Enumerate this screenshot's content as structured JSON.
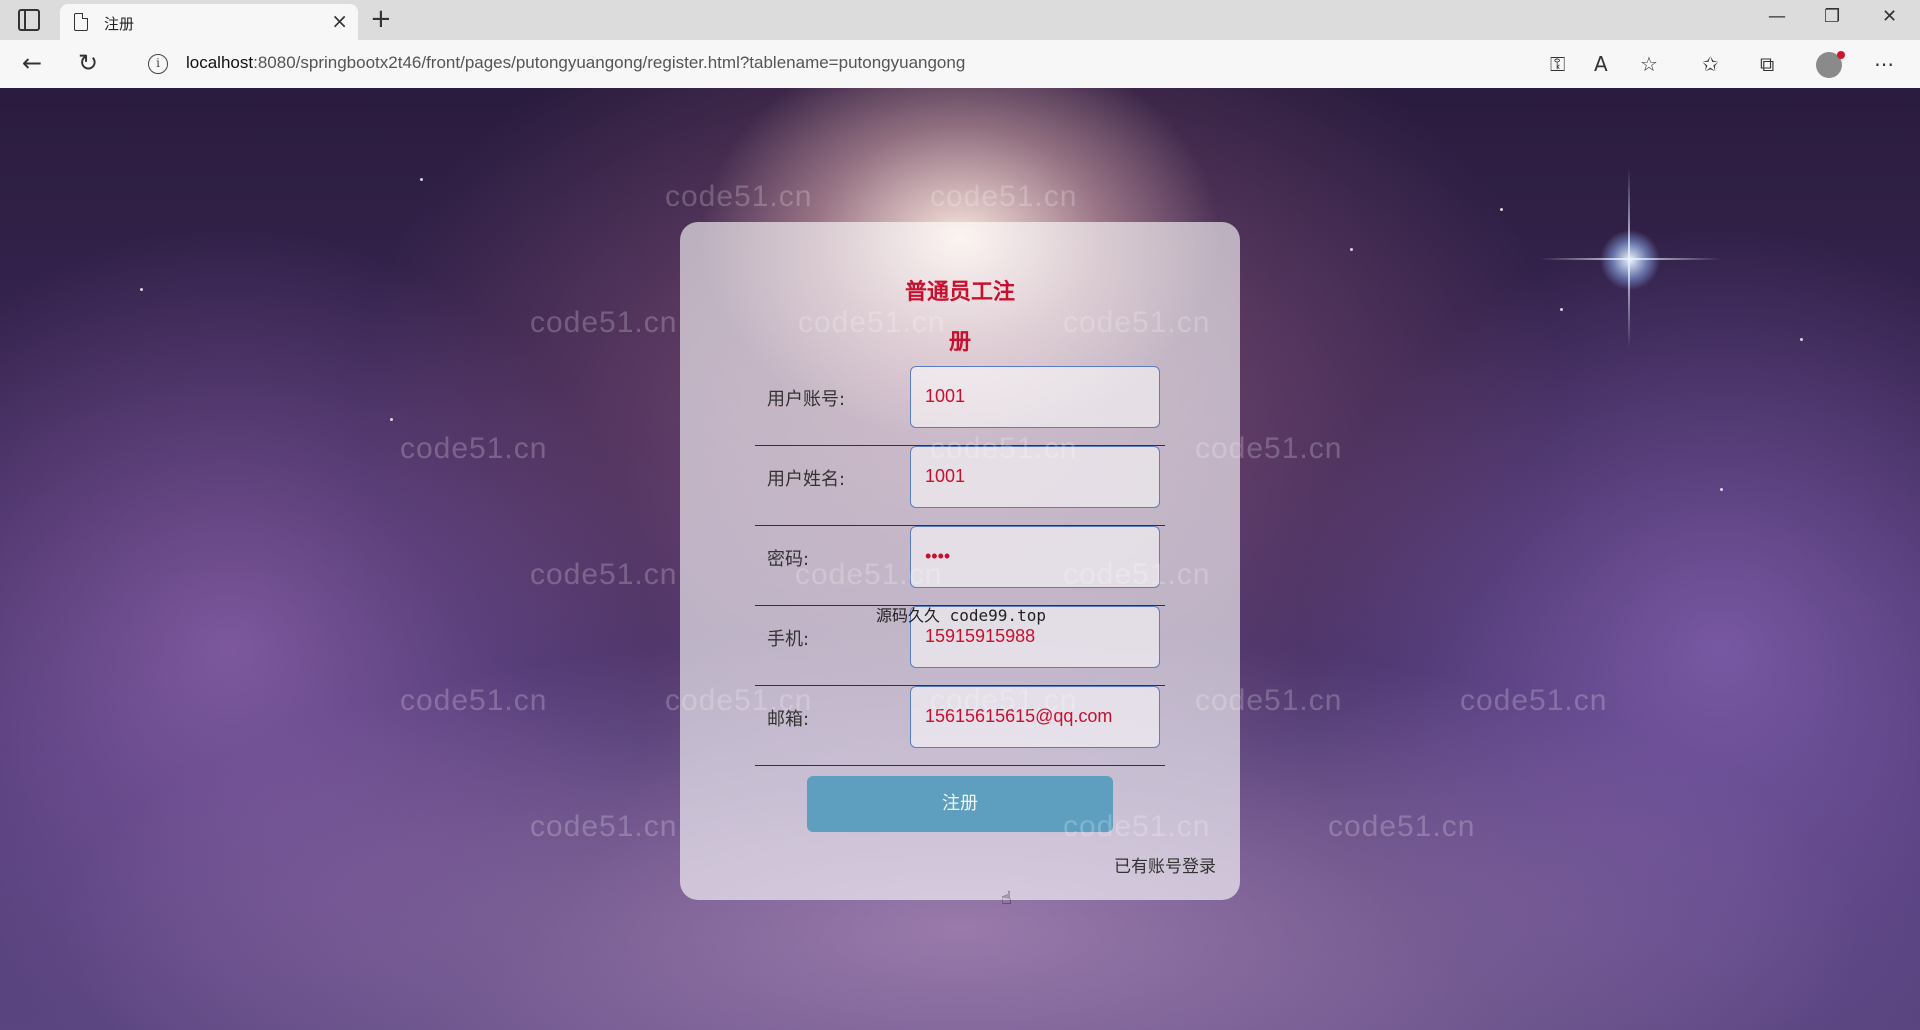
{
  "browser": {
    "tab_title": "注册",
    "url_host": "localhost",
    "url_rest": ":8080/springbootx2t46/front/pages/putongyuangong/register.html?tablename=putongyuangong"
  },
  "watermark": "code51.cn",
  "overlay_text": "源码久久 code99.top",
  "form": {
    "title": "普通员工注册",
    "fields": [
      {
        "label": "用户账号:",
        "value": "1001"
      },
      {
        "label": "用户姓名:",
        "value": "1001"
      },
      {
        "label": "密码:",
        "value": "••••"
      },
      {
        "label": "手机:",
        "value": "15915915988"
      },
      {
        "label": "邮箱:",
        "value": "15615615615@qq.com"
      }
    ],
    "submit_label": "注册",
    "login_link": "已有账号登录"
  },
  "colors": {
    "title": "#c8102e",
    "button": "#5e9fc0",
    "input_border": "#5b7ec2"
  }
}
